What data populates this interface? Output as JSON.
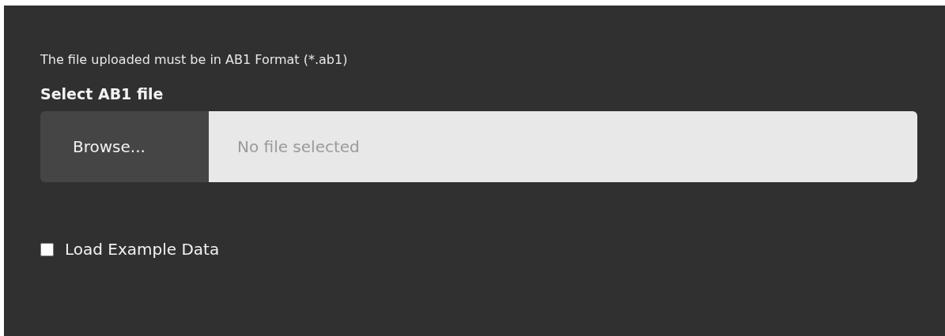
{
  "help_text": "The file uploaded must be in AB1 Format (*.ab1)",
  "file_input": {
    "label": "Select AB1 file",
    "button": "Browse...",
    "placeholder": "No file selected"
  },
  "checkbox": {
    "label": "Load Example Data",
    "checked": false
  }
}
